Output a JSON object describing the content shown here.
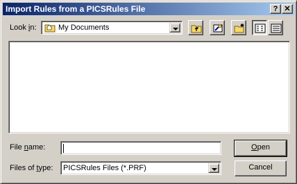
{
  "window": {
    "title": "Import Rules from a PICSRules File",
    "help_label": "?",
    "close_label": "✕"
  },
  "look_in": {
    "label_prefix": "Look ",
    "label_accel": "i",
    "label_suffix": "n:",
    "value": "My Documents",
    "icon": "folder-icon"
  },
  "toolbar": {
    "up_one_level": "up-folder-icon",
    "desktop": "desktop-icon",
    "new_folder": "new-folder-icon",
    "list_view": "list-view-icon",
    "details_view": "details-view-icon"
  },
  "file_name": {
    "label_prefix": "File ",
    "label_accel": "n",
    "label_suffix": "ame:",
    "value": ""
  },
  "file_type": {
    "label_prefix": "Files of ",
    "label_accel": "t",
    "label_suffix": "ype:",
    "value": "PICSRules Files (*.PRF)"
  },
  "buttons": {
    "open_accel": "O",
    "open_suffix": "pen",
    "cancel": "Cancel"
  }
}
